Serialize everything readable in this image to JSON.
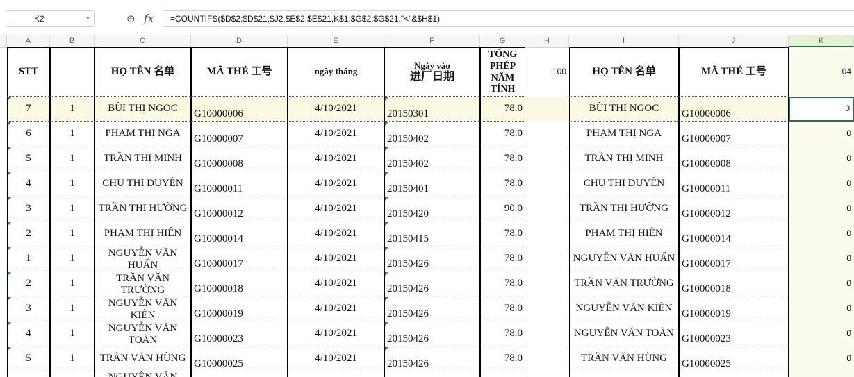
{
  "formula_bar": {
    "name_box": "K2",
    "formula": "=COUNTIFS($D$2:$D$21,$J2,$E$2:$E$21,K$1,$G$2:$G$21,\"<\"&$H$1)"
  },
  "columns": [
    "A",
    "B",
    "C",
    "D",
    "E",
    "F",
    "G",
    "H",
    "I",
    "J",
    "K"
  ],
  "active_column": "K",
  "header": {
    "stt": "STT",
    "b": "",
    "ho_ten": "HỌ TÊN 名单",
    "ma_the": "MÃ THẺ 工号",
    "ngay_thang": "ngày tháng",
    "ngay_vao_1": "Ngày vào",
    "ngay_vao_2": "进厂日期",
    "tong_phep": "TỔNG PHÉP NĂM TÍNH",
    "h1": "100",
    "ho_ten_2": "HỌ TÊN 名单",
    "ma_the_2": "MÃ THẺ 工号",
    "k1": "04"
  },
  "rows": [
    {
      "a": "7",
      "b": "1",
      "c": "BÙI THỊ NGỌC",
      "d": "G10000006",
      "e": "4/10/2021",
      "f": "20150301",
      "g": "78.0",
      "i": "BÙI THỊ NGỌC",
      "j": "G10000006",
      "k": "0"
    },
    {
      "a": "6",
      "b": "1",
      "c": "PHẠM THỊ NGA",
      "d": "G10000007",
      "e": "4/10/2021",
      "f": "20150402",
      "g": "78.0",
      "i": "PHẠM THỊ NGA",
      "j": "G10000007",
      "k": "0"
    },
    {
      "a": "5",
      "b": "1",
      "c": "TRẦN THỊ MINH",
      "d": "G10000008",
      "e": "4/10/2021",
      "f": "20150402",
      "g": "78.0",
      "i": "TRẦN THỊ MINH",
      "j": "G10000008",
      "k": "0"
    },
    {
      "a": "4",
      "b": "1",
      "c": "CHU THỊ DUYÊN",
      "d": "G10000011",
      "e": "4/10/2021",
      "f": "20150401",
      "g": "78.0",
      "i": "CHU THỊ DUYÊN",
      "j": "G10000011",
      "k": "0"
    },
    {
      "a": "3",
      "b": "1",
      "c": "TRẦN THỊ HƯỜNG",
      "d": "G10000012",
      "e": "4/10/2021",
      "f": "20150420",
      "g": "90.0",
      "i": "TRẦN THỊ HƯỜNG",
      "j": "G10000012",
      "k": "0"
    },
    {
      "a": "2",
      "b": "1",
      "c": "PHẠM THỊ HIÊN",
      "d": "G10000014",
      "e": "4/10/2021",
      "f": "20150415",
      "g": "78.0",
      "i": "PHẠM THỊ HIÊN",
      "j": "G10000014",
      "k": "0"
    },
    {
      "a": "1",
      "b": "1",
      "c": "NGUYỄN VĂN HUẤN",
      "d": "G10000017",
      "e": "4/10/2021",
      "f": "20150426",
      "g": "78.0",
      "i": "NGUYỄN VĂN HUẤN",
      "j": "G10000017",
      "k": "0"
    },
    {
      "a": "2",
      "b": "1",
      "c": "TRẦN VĂN TRƯỜNG",
      "d": "G10000018",
      "e": "4/10/2021",
      "f": "20150426",
      "g": "78.0",
      "i": "TRẦN VĂN TRƯỜNG",
      "j": "G10000018",
      "k": "0"
    },
    {
      "a": "3",
      "b": "1",
      "c": "NGUYỄN VĂN KIÊN",
      "d": "G10000019",
      "e": "4/10/2021",
      "f": "20150426",
      "g": "78.0",
      "i": "NGUYỄN VĂN KIÊN",
      "j": "G10000019",
      "k": "0"
    },
    {
      "a": "4",
      "b": "1",
      "c": "NGUYỄN VĂN TOÀN",
      "d": "G10000023",
      "e": "4/10/2021",
      "f": "20150426",
      "g": "78.0",
      "i": "NGUYỄN VĂN TOÀN",
      "j": "G10000023",
      "k": "0"
    },
    {
      "a": "5",
      "b": "1",
      "c": "TRẦN VĂN HÙNG",
      "d": "G10000025",
      "e": "4/10/2021",
      "f": "20150426",
      "g": "78.0",
      "i": "TRẦN VĂN HÙNG",
      "j": "G10000025",
      "k": "0"
    }
  ],
  "partial_row": {
    "c": "NGUYỄN VĂN"
  }
}
